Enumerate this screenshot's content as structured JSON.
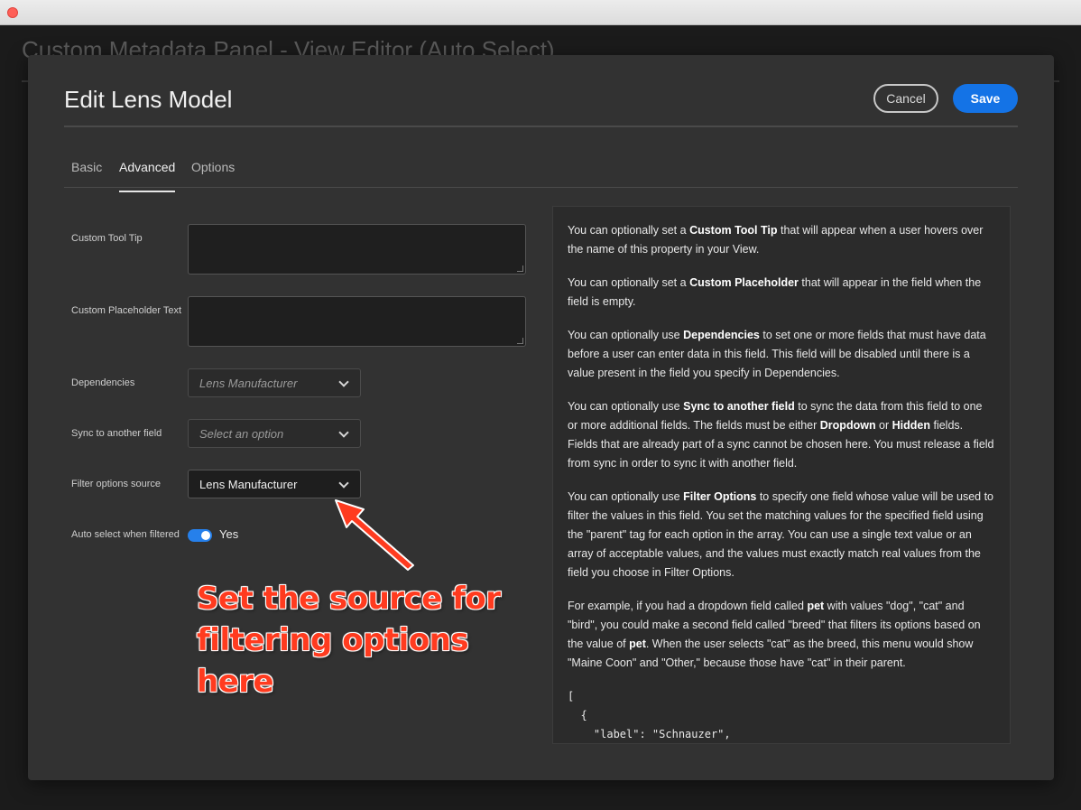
{
  "window": {
    "title": ""
  },
  "background": {
    "title": "Custom Metadata Panel - View Editor (Auto Select)"
  },
  "modal": {
    "title": "Edit Lens Model",
    "cancel_label": "Cancel",
    "save_label": "Save"
  },
  "tabs": [
    {
      "label": "Basic",
      "active": false
    },
    {
      "label": "Advanced",
      "active": true
    },
    {
      "label": "Options",
      "active": false
    }
  ],
  "form": {
    "tooltip_label": "Custom Tool Tip",
    "tooltip_value": "",
    "placeholder_label": "Custom Placeholder Text",
    "placeholder_value": "",
    "dependencies_label": "Dependencies",
    "dependencies_value": "Lens Manufacturer",
    "sync_label": "Sync to another field",
    "sync_value": "Select an option",
    "filter_label": "Filter options source",
    "filter_value": "Lens Manufacturer",
    "auto_select_label": "Auto select when filtered",
    "auto_select_state": "Yes"
  },
  "help": {
    "p1": [
      "You can optionally set a ",
      "Custom Tool Tip",
      " that will appear when a user hovers over the name of this property in your View."
    ],
    "p2": [
      "You can optionally set a ",
      "Custom Placeholder",
      " that will appear in the field when the field is empty."
    ],
    "p3": [
      "You can optionally use ",
      "Dependencies",
      " to set one or more fields that must have data before a user can enter data in this field. This field will be disabled until there is a value present in the field you specify in Dependencies."
    ],
    "p4": [
      "You can optionally use ",
      "Sync to another field",
      " to sync the data from this field to one or more additional fields. The fields must be either ",
      "Dropdown",
      " or ",
      "Hidden",
      " fields. Fields that are already part of a sync cannot be chosen here. You must release a field from sync in order to sync it with another field."
    ],
    "p5": [
      "You can optionally use ",
      "Filter Options",
      " to specify one field whose value will be used to filter the values in this field. You set the matching values for the specified field using the \"parent\" tag for each option in the array. You can use a single text value or an array of acceptable values, and the values must exactly match real values from the field you choose in Filter Options."
    ],
    "p6": [
      "For example, if you had a dropdown field called ",
      "pet",
      " with values \"dog\", \"cat\" and \"bird\", you could make a second field called \"breed\" that filters its options based on the value of ",
      "pet",
      ". When the user selects \"cat\" as the breed, this menu would show \"Maine Coon\" and \"Other,\" because those have \"cat\" in their parent."
    ],
    "code": "[\n  {\n    \"label\": \"Schnauzer\",\n    \"value\": \"schnauzer\","
  },
  "annotation": {
    "text": "Set the source for filtering options here",
    "color": "#ff3b1f"
  },
  "colors": {
    "accent": "#1473e6",
    "panel": "#323232"
  }
}
